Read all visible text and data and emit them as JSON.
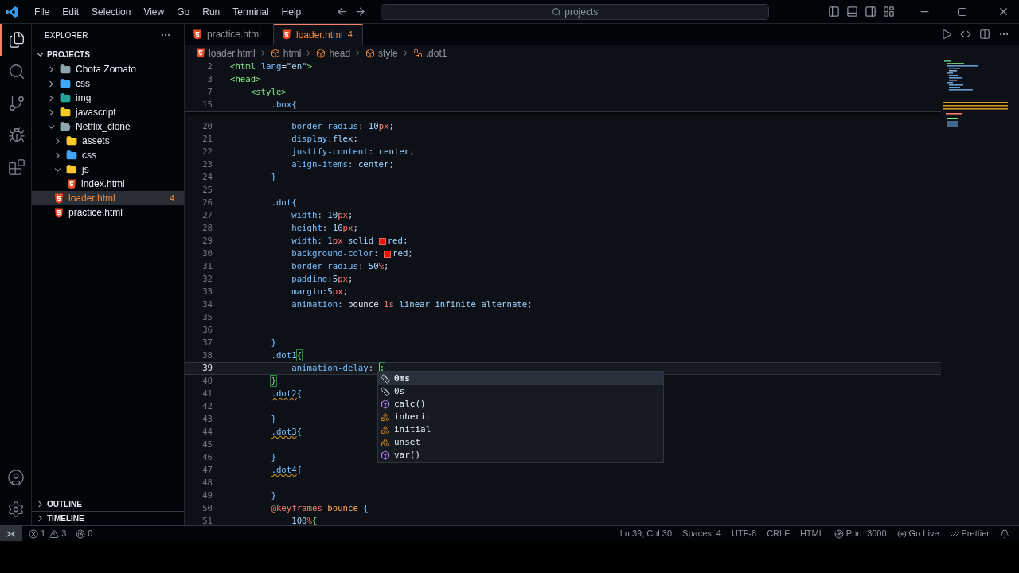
{
  "menu": [
    "File",
    "Edit",
    "Selection",
    "View",
    "Go",
    "Run",
    "Terminal",
    "Help"
  ],
  "command_center": "projects",
  "activity_bar": [
    {
      "kind": "explorer",
      "selected": true
    },
    {
      "kind": "search",
      "selected": false
    },
    {
      "kind": "source-control",
      "selected": false
    },
    {
      "kind": "debug",
      "selected": false
    },
    {
      "kind": "extensions",
      "selected": false
    }
  ],
  "activity_bottom": [
    {
      "kind": "account"
    },
    {
      "kind": "settings"
    }
  ],
  "sidebar": {
    "title": "EXPLORER",
    "section": "PROJECTS",
    "tree": [
      {
        "label": "Chota Zomato",
        "kind": "folder",
        "color": "#90a4ae",
        "expanded": false,
        "selected": false
      },
      {
        "label": "css",
        "kind": "folder",
        "color": "#42a5f5",
        "expanded": false,
        "selected": false
      },
      {
        "label": "img",
        "kind": "folder",
        "color": "#26a69a",
        "expanded": false,
        "selected": false
      },
      {
        "label": "javascript",
        "kind": "folder",
        "color": "#ffca28",
        "expanded": false,
        "selected": false
      },
      {
        "label": "Netflix_clone",
        "kind": "folder",
        "color": "#90a4ae",
        "expanded": true,
        "selected": false,
        "children": [
          {
            "label": "assets",
            "kind": "folder",
            "color": "#ffca28",
            "expanded": false,
            "selected": false
          },
          {
            "label": "css",
            "kind": "folder",
            "color": "#42a5f5",
            "expanded": false,
            "selected": false
          },
          {
            "label": "js",
            "kind": "folder",
            "color": "#ffca28",
            "expanded": true,
            "selected": false,
            "children": [
              {
                "label": "index.html",
                "kind": "file",
                "selected": false
              }
            ]
          }
        ]
      },
      {
        "label": "loader.html",
        "kind": "file",
        "selected": true,
        "badge": "4"
      },
      {
        "label": "practice.html",
        "kind": "file",
        "selected": false
      }
    ],
    "panels": [
      {
        "label": "OUTLINE",
        "expanded": false
      },
      {
        "label": "TIMELINE",
        "expanded": false
      }
    ]
  },
  "tabs": [
    {
      "label": "practice.html",
      "selected": false
    },
    {
      "label": "loader.html",
      "selected": true,
      "badge": "4"
    }
  ],
  "breadcrumb": [
    {
      "label": "loader.html",
      "kind": "file"
    },
    {
      "label": "html",
      "kind": "element"
    },
    {
      "label": "head",
      "kind": "element"
    },
    {
      "label": "style",
      "kind": "element"
    },
    {
      "label": ".dot1",
      "kind": "symbol"
    }
  ],
  "sticky_lines": [
    {
      "n": "2",
      "toks": [
        {
          "t": "<html",
          "kind": "tag"
        },
        {
          "t": " lang",
          "kind": "attr"
        },
        {
          "t": "=",
          "kind": "punct"
        },
        {
          "t": "\"en\"",
          "kind": "str"
        },
        {
          "t": ">",
          "kind": "tag"
        }
      ]
    },
    {
      "n": "3",
      "toks": [
        {
          "t": "<head>",
          "kind": "tag"
        }
      ]
    },
    {
      "n": "7",
      "toks": [
        {
          "t": "    <style>",
          "kind": "tag"
        }
      ]
    },
    {
      "n": "15",
      "toks": [
        {
          "t": "        .box{",
          "kind": "sel"
        }
      ]
    }
  ],
  "lines": [
    {
      "n": "20",
      "toks": [
        {
          "t": "            border-radius",
          "kind": "prop"
        },
        {
          "t": ": ",
          "kind": "punct"
        },
        {
          "t": "10",
          "kind": "num"
        },
        {
          "t": "px",
          "kind": "unit"
        },
        {
          "t": ";",
          "kind": "punct"
        }
      ]
    },
    {
      "n": "21",
      "toks": [
        {
          "t": "            display",
          "kind": "prop"
        },
        {
          "t": ":",
          "kind": "punct"
        },
        {
          "t": "flex",
          "kind": "val"
        },
        {
          "t": ";",
          "kind": "punct"
        }
      ]
    },
    {
      "n": "22",
      "toks": [
        {
          "t": "            justify-content",
          "kind": "prop"
        },
        {
          "t": ": ",
          "kind": "punct"
        },
        {
          "t": "center",
          "kind": "val"
        },
        {
          "t": ";",
          "kind": "punct"
        }
      ]
    },
    {
      "n": "23",
      "toks": [
        {
          "t": "            align-items",
          "kind": "prop"
        },
        {
          "t": ": ",
          "kind": "punct"
        },
        {
          "t": "center",
          "kind": "val"
        },
        {
          "t": ";",
          "kind": "punct"
        }
      ]
    },
    {
      "n": "24",
      "toks": [
        {
          "t": "        }",
          "kind": "sel"
        }
      ]
    },
    {
      "n": "25"
    },
    {
      "n": "26",
      "toks": [
        {
          "t": "        .dot{",
          "kind": "sel"
        }
      ]
    },
    {
      "n": "27",
      "toks": [
        {
          "t": "            width",
          "kind": "prop"
        },
        {
          "t": ": ",
          "kind": "punct"
        },
        {
          "t": "10",
          "kind": "num"
        },
        {
          "t": "px",
          "kind": "unit"
        },
        {
          "t": ";",
          "kind": "punct"
        }
      ]
    },
    {
      "n": "28",
      "toks": [
        {
          "t": "            height",
          "kind": "prop"
        },
        {
          "t": ": ",
          "kind": "punct"
        },
        {
          "t": "10",
          "kind": "num"
        },
        {
          "t": "px",
          "kind": "unit"
        },
        {
          "t": ";",
          "kind": "punct"
        }
      ]
    },
    {
      "n": "29",
      "toks": [
        {
          "t": "            width",
          "kind": "prop"
        },
        {
          "t": ": ",
          "kind": "punct"
        },
        {
          "t": "1",
          "kind": "num"
        },
        {
          "t": "px",
          "kind": "unit"
        },
        {
          "t": " solid ",
          "kind": "val"
        },
        {
          "kind": "swatch",
          "color": "#e51400"
        },
        {
          "t": "red",
          "kind": "val"
        },
        {
          "t": ";",
          "kind": "punct"
        }
      ]
    },
    {
      "n": "30",
      "toks": [
        {
          "t": "            background-color",
          "kind": "prop"
        },
        {
          "t": ": ",
          "kind": "punct"
        },
        {
          "kind": "swatch",
          "color": "#e51400"
        },
        {
          "t": "red",
          "kind": "val"
        },
        {
          "t": ";",
          "kind": "punct"
        }
      ]
    },
    {
      "n": "31",
      "toks": [
        {
          "t": "            border-radius",
          "kind": "prop"
        },
        {
          "t": ": ",
          "kind": "punct"
        },
        {
          "t": "50",
          "kind": "num"
        },
        {
          "t": "%",
          "kind": "unit"
        },
        {
          "t": ";",
          "kind": "punct"
        }
      ]
    },
    {
      "n": "32",
      "toks": [
        {
          "t": "            padding",
          "kind": "prop"
        },
        {
          "t": ":",
          "kind": "punct"
        },
        {
          "t": "5",
          "kind": "num"
        },
        {
          "t": "px",
          "kind": "unit"
        },
        {
          "t": ";",
          "kind": "punct"
        }
      ]
    },
    {
      "n": "33",
      "toks": [
        {
          "t": "            margin",
          "kind": "prop"
        },
        {
          "t": ":",
          "kind": "punct"
        },
        {
          "t": "5",
          "kind": "num"
        },
        {
          "t": "px",
          "kind": "unit"
        },
        {
          "t": ";",
          "kind": "punct"
        }
      ]
    },
    {
      "n": "34",
      "toks": [
        {
          "t": "            animation",
          "kind": "prop"
        },
        {
          "t": ": ",
          "kind": "punct"
        },
        {
          "t": "bounce ",
          "kind": "name"
        },
        {
          "t": "1s",
          "kind": "unit"
        },
        {
          "t": " linear infinite alternate",
          "kind": "val"
        },
        {
          "t": ";",
          "kind": "punct"
        }
      ]
    },
    {
      "n": "35"
    },
    {
      "n": "36"
    },
    {
      "n": "37",
      "toks": [
        {
          "t": "        }",
          "kind": "sel"
        }
      ]
    },
    {
      "n": "38",
      "toks": [
        {
          "t": "        .dot1",
          "kind": "sel"
        },
        {
          "t": "{",
          "kind": "match"
        }
      ]
    },
    {
      "n": "39",
      "current": true,
      "toks": [
        {
          "t": "            animation-delay",
          "kind": "prop"
        },
        {
          "t": ": ",
          "kind": "punct"
        },
        {
          "kind": "cursor"
        },
        {
          "t": ";",
          "kind": "match"
        }
      ]
    },
    {
      "n": "40",
      "toks": [
        {
          "t": "        }",
          "kind": "match"
        }
      ]
    },
    {
      "n": "41",
      "toks": [
        {
          "t": "        .dot2",
          "kind": "warnsel"
        },
        {
          "t": "{",
          "kind": "sel"
        }
      ]
    },
    {
      "n": "42"
    },
    {
      "n": "43",
      "toks": [
        {
          "t": "        }",
          "kind": "sel"
        }
      ]
    },
    {
      "n": "44",
      "toks": [
        {
          "t": "        .dot3",
          "kind": "warnsel"
        },
        {
          "t": "{",
          "kind": "sel"
        }
      ]
    },
    {
      "n": "45"
    },
    {
      "n": "46",
      "toks": [
        {
          "t": "        }",
          "kind": "sel"
        }
      ]
    },
    {
      "n": "47",
      "toks": [
        {
          "t": "        .dot4",
          "kind": "warnsel"
        },
        {
          "t": "{",
          "kind": "sel"
        }
      ]
    },
    {
      "n": "48"
    },
    {
      "n": "49",
      "toks": [
        {
          "t": "        }",
          "kind": "sel"
        }
      ]
    },
    {
      "n": "50",
      "toks": [
        {
          "t": "        @keyframes",
          "kind": "atkw"
        },
        {
          "t": " bounce ",
          "kind": "anim"
        },
        {
          "t": "{",
          "kind": "sel"
        }
      ]
    },
    {
      "n": "51",
      "toks": [
        {
          "t": "            100",
          "kind": "num"
        },
        {
          "t": "%",
          "kind": "unit"
        },
        {
          "t": "{",
          "kind": "brace2"
        }
      ]
    }
  ],
  "suggestions": [
    {
      "label": "0ms",
      "kind": "unit",
      "selected": true
    },
    {
      "label": "0s",
      "kind": "unit",
      "selected": false
    },
    {
      "label": "calc()",
      "kind": "function",
      "selected": false
    },
    {
      "label": "inherit",
      "kind": "keyword",
      "selected": false
    },
    {
      "label": "initial",
      "kind": "keyword",
      "selected": false
    },
    {
      "label": "unset",
      "kind": "keyword",
      "selected": false
    },
    {
      "label": "var()",
      "kind": "function",
      "selected": false
    }
  ],
  "status_bar": {
    "errors": "1",
    "warnings": "3",
    "ports": "0",
    "right": [
      {
        "label": "Ln 39, Col 30",
        "kind": "text"
      },
      {
        "label": "Spaces: 4",
        "kind": "text"
      },
      {
        "label": "UTF-8",
        "kind": "text"
      },
      {
        "label": "CRLF",
        "kind": "text"
      },
      {
        "label": "HTML",
        "kind": "text"
      },
      {
        "label": "Port: 3000",
        "kind": "port"
      },
      {
        "label": "Go Live",
        "kind": "live"
      },
      {
        "label": "Prettier",
        "kind": "prettier"
      }
    ]
  }
}
